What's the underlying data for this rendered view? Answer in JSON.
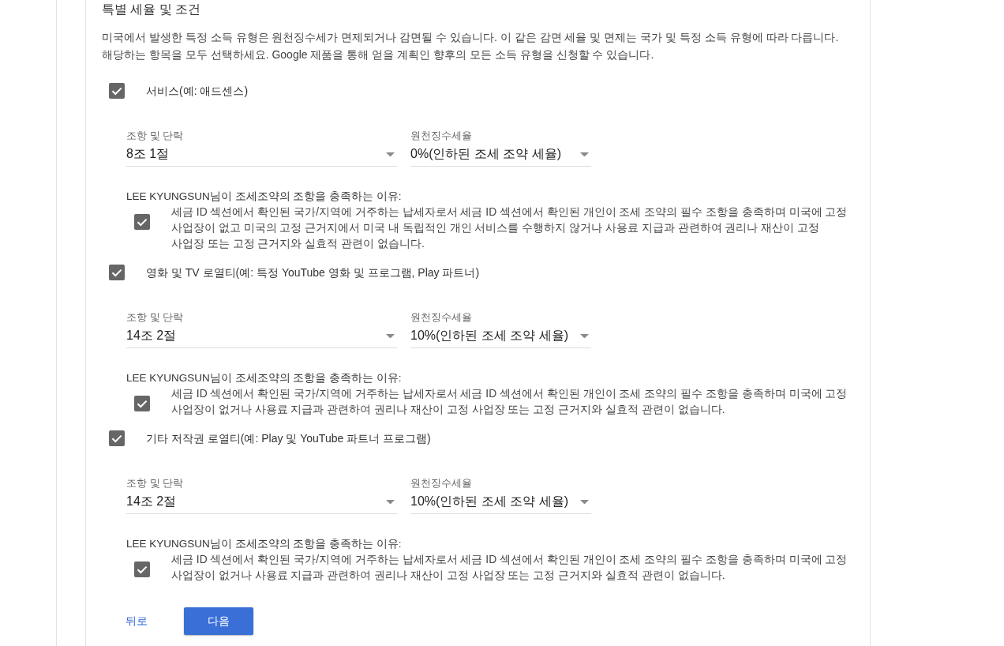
{
  "form": {
    "title": "특별 세율 및 조건",
    "description": "미국에서 발생한 특정 소득 유형은 원천징수세가 면제되거나 감면될 수 있습니다. 이 같은 감면 세율 및 면제는 국가 및 특정 소득 유형에 따라 다릅니다. 해당하는 항목을 모두 선택하세요. Google 제품을 통해 얻을 계획인 향후의 모든 소득 유형을 신청할 수 있습니다."
  },
  "income_types": [
    {
      "label": "서비스(예: 애드센스)",
      "checked": true,
      "clause": {
        "label": "조항 및 단락",
        "value": "8조 1절"
      },
      "rate": {
        "label": "원천징수세율",
        "value": "0%(인하된 조세 조약 세율)"
      },
      "reason_heading": "LEE KYUNGSUN님이 조세조약의 조항을 충족하는 이유:",
      "reason": {
        "checked": true,
        "text": "세금 ID 섹션에서 확인된 국가/지역에 거주하는 납세자로서 세금 ID 섹션에서 확인된 개인이 조세 조약의 필수 조항을 충족하며 미국에 고정 사업장이 없고 미국의 고정 근거지에서 미국 내 독립적인 개인 서비스를 수행하지 않거나 사용료 지급과 관련하여 권리나 재산이 고정 사업장 또는 고정 근거지와 실효적 관련이 없습니다."
      }
    },
    {
      "label": "영화 및 TV 로열티(예: 특정 YouTube 영화 및 프로그램, Play 파트너)",
      "checked": true,
      "clause": {
        "label": "조항 및 단락",
        "value": "14조 2절"
      },
      "rate": {
        "label": "원천징수세율",
        "value": "10%(인하된 조세 조약 세율)"
      },
      "reason_heading": "LEE KYUNGSUN님이 조세조약의 조항을 충족하는 이유:",
      "reason": {
        "checked": true,
        "text": "세금 ID 섹션에서 확인된 국가/지역에 거주하는 납세자로서 세금 ID 섹션에서 확인된 개인이 조세 조약의 필수 조항을 충족하며 미국에 고정 사업장이 없거나 사용료 지급과 관련하여 권리나 재산이 고정 사업장 또는 고정 근거지와 실효적 관련이 없습니다."
      }
    },
    {
      "label": "기타 저작권 로열티(예: Play 및 YouTube 파트너 프로그램)",
      "checked": true,
      "clause": {
        "label": "조항 및 단락",
        "value": "14조 2절"
      },
      "rate": {
        "label": "원천징수세율",
        "value": "10%(인하된 조세 조약 세율)"
      },
      "reason_heading": "LEE KYUNGSUN님이 조세조약의 조항을 충족하는 이유:",
      "reason": {
        "checked": true,
        "text": "세금 ID 섹션에서 확인된 국가/지역에 거주하는 납세자로서 세금 ID 섹션에서 확인된 개인이 조세 조약의 필수 조항을 충족하며 미국에 고정 사업장이 없거나 사용료 지급과 관련하여 권리나 재산이 고정 사업장 또는 고정 근거지와 실효적 관련이 없습니다."
      }
    }
  ],
  "buttons": [
    {
      "label": "뒤로",
      "kind": "text"
    },
    {
      "label": "다음",
      "kind": "primary"
    }
  ]
}
